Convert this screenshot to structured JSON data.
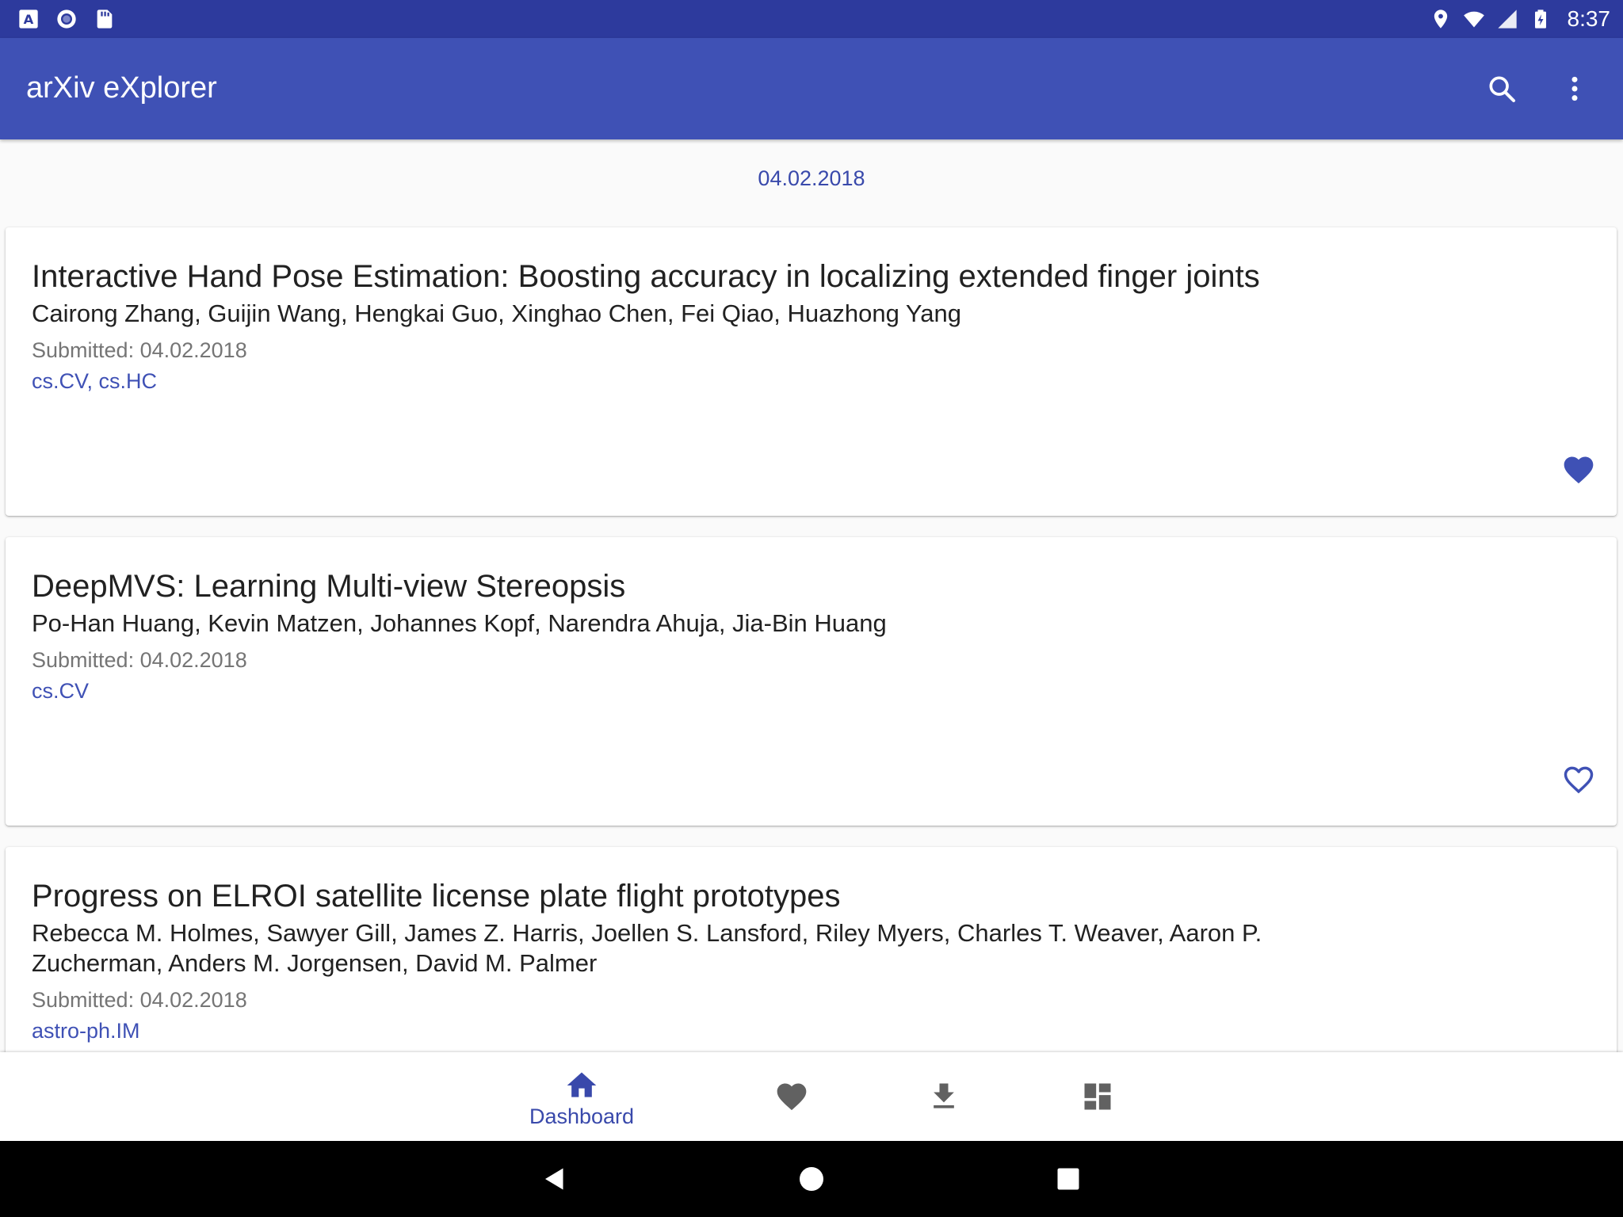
{
  "status_bar": {
    "left_icons": [
      "font-a-icon",
      "circle-icon",
      "sd-card-icon"
    ],
    "right_icons": [
      "location-icon",
      "wifi-icon",
      "signal-icon",
      "battery-charging-icon"
    ],
    "time": "8:37"
  },
  "app_bar": {
    "title": "arXiv eXplorer",
    "actions": [
      "search-icon",
      "more-vert-icon"
    ]
  },
  "date_header": "04.02.2018",
  "papers": [
    {
      "title": "Interactive Hand Pose Estimation: Boosting accuracy in localizing extended finger joints",
      "authors": "Cairong Zhang, Guijin Wang, Hengkai Guo, Xinghao Chen, Fei Qiao, Huazhong Yang",
      "submitted_label": "Submitted: ",
      "submitted_date": "04.02.2018",
      "categories": "cs.CV, cs.HC",
      "favorited": true
    },
    {
      "title": "DeepMVS: Learning Multi-view Stereopsis",
      "authors": "Po-Han Huang, Kevin Matzen, Johannes Kopf, Narendra Ahuja, Jia-Bin Huang",
      "submitted_label": "Submitted: ",
      "submitted_date": "04.02.2018",
      "categories": "cs.CV",
      "favorited": false
    },
    {
      "title": "Progress on ELROI satellite license plate flight prototypes",
      "authors": "Rebecca M. Holmes, Sawyer Gill, James Z. Harris, Joellen S. Lansford, Riley Myers, Charles T. Weaver, Aaron P. Zucherman, Anders M. Jorgensen, David M. Palmer",
      "submitted_label": "Submitted: ",
      "submitted_date": "04.02.2018",
      "categories": "astro-ph.IM",
      "favorited": false
    }
  ],
  "bottom_nav": {
    "items": [
      {
        "label": "Dashboard",
        "icon": "home-icon",
        "active": true
      },
      {
        "label": "",
        "icon": "favorites-heart-icon",
        "active": false
      },
      {
        "label": "",
        "icon": "download-icon",
        "active": false
      },
      {
        "label": "",
        "icon": "dashboard-grid-icon",
        "active": false
      }
    ]
  },
  "system_nav": [
    "back-icon",
    "home-circle-icon",
    "recents-square-icon"
  ],
  "colors": {
    "status_bar": "#2d3a9d",
    "app_bar": "#3f51b5",
    "accent": "#3f51b5",
    "inactive_icon": "#616161"
  }
}
